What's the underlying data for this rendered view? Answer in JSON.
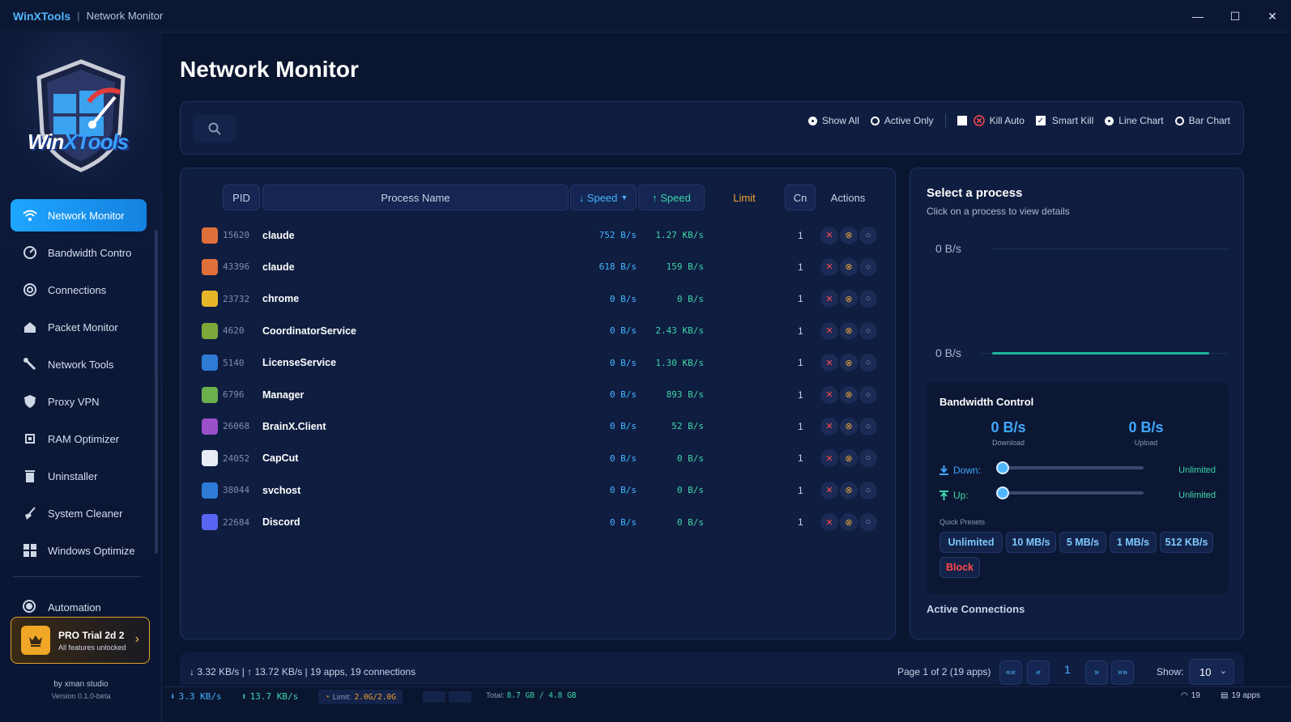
{
  "window": {
    "app_name": "WinXTools",
    "separator": "|",
    "title": "Network Monitor",
    "minimize": "—",
    "maximize": "☐",
    "close": "✕"
  },
  "sidebar": {
    "logo_text_pre": "Win",
    "logo_text_x": "X",
    "logo_text_post": "Tools",
    "items": [
      {
        "label": "Network Monitor",
        "icon": "wifi-icon",
        "active": true
      },
      {
        "label": "Bandwidth Contro",
        "icon": "gauge-icon"
      },
      {
        "label": "Connections",
        "icon": "target-icon"
      },
      {
        "label": "Packet Monitor",
        "icon": "home-icon"
      },
      {
        "label": "Network Tools",
        "icon": "wrench-icon"
      },
      {
        "label": "Proxy VPN",
        "icon": "shield-icon"
      },
      {
        "label": "RAM Optimizer",
        "icon": "chip-icon"
      },
      {
        "label": "Uninstaller",
        "icon": "trash-icon"
      },
      {
        "label": "System Cleaner",
        "icon": "broom-icon"
      },
      {
        "label": "Windows Optimize",
        "icon": "windows-icon"
      }
    ],
    "automation": "Automation",
    "pro": {
      "title": "PRO Trial  2d  2",
      "subtitle": "All features unlocked"
    },
    "credits": {
      "by": "by xman studio",
      "version": "Version 0.1.0-beta"
    }
  },
  "main": {
    "title": "Network Monitor",
    "search": {
      "placeholder": ""
    },
    "filters": {
      "show_all": "Show All",
      "active_only": "Active Only",
      "kill_auto": "Kill Auto",
      "smart_kill": "Smart Kill",
      "line_chart": "Line Chart",
      "bar_chart": "Bar Chart"
    },
    "table": {
      "headers": {
        "pid": "PID",
        "process_name": "Process Name",
        "down_speed": "↓ Speed",
        "up_speed": "↑ Speed",
        "limit": "Limit",
        "cn": "Cn",
        "actions": "Actions"
      },
      "rows": [
        {
          "pid": "15620",
          "name": "claude",
          "down": "752 B/s",
          "up": "1.27 KB/s",
          "cn": "1",
          "icon_color": "#e0703a"
        },
        {
          "pid": "43396",
          "name": "claude",
          "down": "618 B/s",
          "up": "159 B/s",
          "cn": "1",
          "icon_color": "#e0703a"
        },
        {
          "pid": "23732",
          "name": "chrome",
          "down": "0 B/s",
          "up": "0 B/s",
          "cn": "1",
          "icon_color": "#e6b62a"
        },
        {
          "pid": "4620",
          "name": "CoordinatorService",
          "down": "0 B/s",
          "up": "2.43 KB/s",
          "cn": "1",
          "icon_color": "#7ca83a"
        },
        {
          "pid": "5140",
          "name": "LicenseService",
          "down": "0 B/s",
          "up": "1.30 KB/s",
          "cn": "1",
          "icon_color": "#2e7bd6"
        },
        {
          "pid": "6796",
          "name": "Manager",
          "down": "0 B/s",
          "up": "893 B/s",
          "cn": "1",
          "icon_color": "#6ab04c"
        },
        {
          "pid": "26068",
          "name": "BrainX.Client",
          "down": "0 B/s",
          "up": "52 B/s",
          "cn": "1",
          "icon_color": "#9b4fc9"
        },
        {
          "pid": "24052",
          "name": "CapCut",
          "down": "0 B/s",
          "up": "0 B/s",
          "cn": "1",
          "icon_color": "#e8ecf4"
        },
        {
          "pid": "38044",
          "name": "svchost",
          "down": "0 B/s",
          "up": "0 B/s",
          "cn": "1",
          "icon_color": "#2e7bd6"
        },
        {
          "pid": "22684",
          "name": "Discord",
          "down": "0 B/s",
          "up": "0 B/s",
          "cn": "1",
          "icon_color": "#5865f2"
        }
      ]
    },
    "detail": {
      "title": "Select a process",
      "subtitle": "Click on a process to view details",
      "chart_top": "0 B/s",
      "chart_bottom": "0 B/s",
      "bandwidth": {
        "title": "Bandwidth Control",
        "download_value": "0 B/s",
        "download_caption": "Download",
        "upload_value": "0 B/s",
        "upload_caption": "Upload",
        "down_label": "Down:",
        "up_label": "Up:",
        "down_limit": "Unlimited",
        "up_limit": "Unlimited",
        "quick_presets_label": "Quick Presets",
        "presets": [
          "Unlimited",
          "10 MB/s",
          "5 MB/s",
          "1 MB/s",
          "512 KB/s"
        ],
        "block": "Block"
      },
      "active_connections": "Active Connections"
    },
    "pagination": {
      "summary": "↓ 3.32 KB/s | ↑ 13.72 KB/s | 19 apps, 19 connections",
      "page_info": "Page 1 of 2 (19 apps)",
      "first": "««",
      "prev": "«",
      "current": "1",
      "next": "»",
      "last": "»»",
      "show_label": "Show:",
      "show_value": "10"
    }
  },
  "statusbar": {
    "down": "3.3 KB/s",
    "up": "13.7 KB/s",
    "limit_label": "Limit:",
    "limit_value": "2.0G/2.0G",
    "total_label": "Total:",
    "total_value": "8.7 GB / 4.8 GB",
    "wifi_count": "19",
    "apps": "19 apps"
  },
  "colors": {
    "accent": "#1ea6ff",
    "download": "#45b4ff",
    "upload": "#3ed6a8",
    "limit": "#f2a12e",
    "danger": "#ff4a4a"
  }
}
